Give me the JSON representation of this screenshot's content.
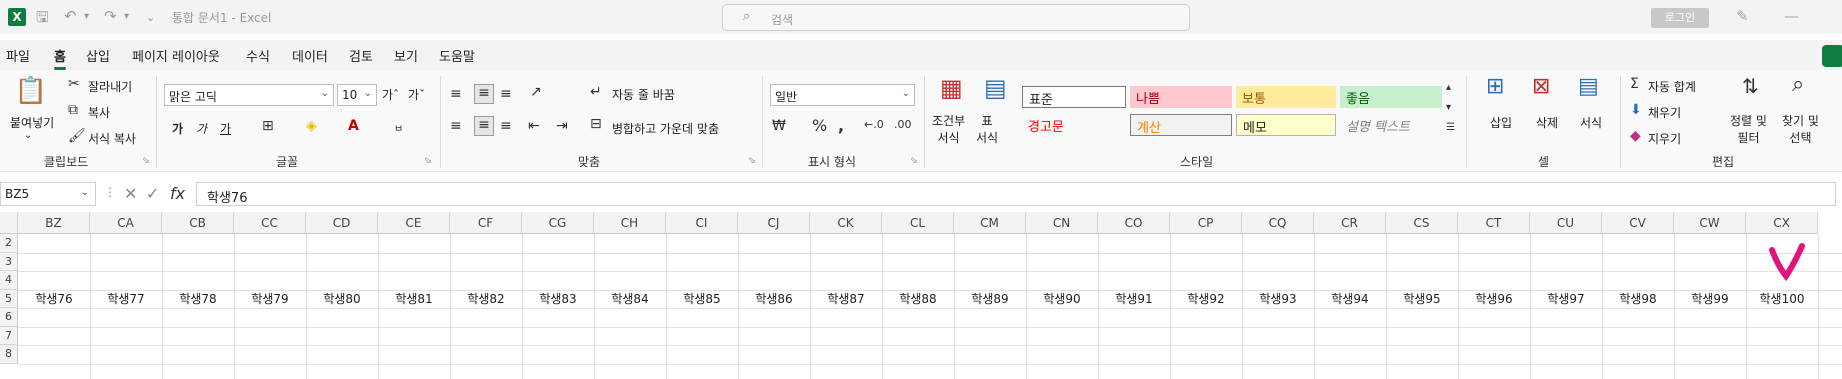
{
  "titlebar": {
    "logo": "X",
    "doc_title": "통합 문서1 - Excel",
    "search_placeholder": "검색",
    "login_label": "로그인",
    "customize_glyph": "⌄"
  },
  "tabs": [
    "파일",
    "홈",
    "삽입",
    "페이지 레이아웃",
    "수식",
    "데이터",
    "검토",
    "보기",
    "도움말"
  ],
  "ribbon": {
    "clipboard": {
      "paste": "붙여넣기",
      "cut": "잘라내기",
      "copy": "복사",
      "format_painter": "서식 복사",
      "label": "클립보드"
    },
    "font": {
      "font_name": "맑은 고딕",
      "font_size": "10",
      "grow": "가ˆ",
      "shrink": "가ˇ",
      "bold": "가",
      "italic": "가",
      "underline": "가",
      "label": "글꼴"
    },
    "alignment": {
      "wrap_text": "자동 줄 바꿈",
      "merge_center": "병합하고 가운데 맞춤",
      "label": "맞춤"
    },
    "number": {
      "format": "일반",
      "label": "표시 형식"
    },
    "styles": {
      "conditional": "조건부\n서식",
      "table": "표\n서식",
      "normal": "표준",
      "bad": "나쁨",
      "neutral": "보통",
      "good": "좋음",
      "warning": "경고문",
      "calc": "계산",
      "note": "메모",
      "explanatory": "설명 텍스트",
      "label": "스타일"
    },
    "cells": {
      "insert": "삽입",
      "delete": "삭제",
      "format": "서식",
      "label": "셀"
    },
    "editing": {
      "autosum": "자동 합계",
      "fill": "채우기",
      "clear": "지우기",
      "sort_filter": "정렬 및\n필터",
      "find_select": "찾기 및\n선택",
      "label": "편집"
    }
  },
  "formula_bar": {
    "name_box": "BZ5",
    "fx": "fx",
    "value": "학생76"
  },
  "columns": [
    "BZ",
    "CA",
    "CB",
    "CC",
    "CD",
    "CE",
    "CF",
    "CG",
    "CH",
    "CI",
    "CJ",
    "CK",
    "CL",
    "CM",
    "CN",
    "CO",
    "CP",
    "CQ",
    "CR",
    "CS",
    "CT",
    "CU",
    "CV",
    "CW",
    "CX"
  ],
  "rows": [
    "2",
    "3",
    "4",
    "5",
    "6",
    "7",
    "8"
  ],
  "row5_values": [
    "학생76",
    "학생77",
    "학생78",
    "학생79",
    "학생80",
    "학생81",
    "학생82",
    "학생83",
    "학생84",
    "학생85",
    "학생86",
    "학생87",
    "학생88",
    "학생89",
    "학생90",
    "학생91",
    "학생92",
    "학생93",
    "학생94",
    "학생95",
    "학생96",
    "학생97",
    "학생98",
    "학생99",
    "학생100"
  ],
  "colors": {
    "accent": "#107c41",
    "checkmark": "#e0147d"
  }
}
